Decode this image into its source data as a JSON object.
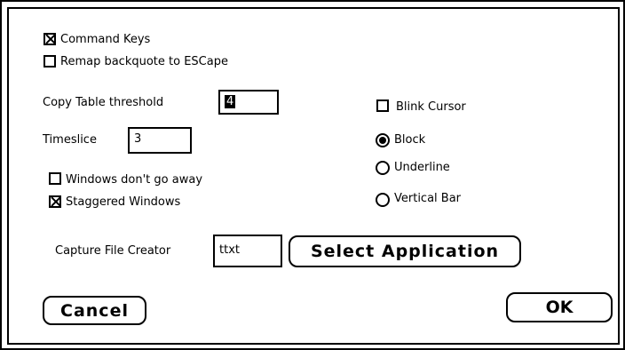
{
  "checkboxes": {
    "command_keys": {
      "label": "Command Keys",
      "checked": true
    },
    "remap_backquote": {
      "label": "Remap backquote to ESCape",
      "checked": false
    },
    "blink_cursor": {
      "label": "Blink Cursor",
      "checked": false
    },
    "windows_dont_go_away": {
      "label": "Windows don't go away",
      "checked": false
    },
    "staggered_windows": {
      "label": "Staggered Windows",
      "checked": true
    }
  },
  "fields": {
    "copy_table_threshold": {
      "label": "Copy Table threshold",
      "value": "4"
    },
    "timeslice": {
      "label": "Timeslice",
      "value": "3"
    },
    "capture_file_creator": {
      "label": "Capture File Creator",
      "value": "ttxt"
    }
  },
  "cursor_style": {
    "options": [
      {
        "label": "Block",
        "selected": true
      },
      {
        "label": "Underline",
        "selected": false
      },
      {
        "label": "Vertical Bar",
        "selected": false
      }
    ]
  },
  "buttons": {
    "select_application": "Select Application",
    "cancel": "Cancel",
    "ok": "OK"
  }
}
